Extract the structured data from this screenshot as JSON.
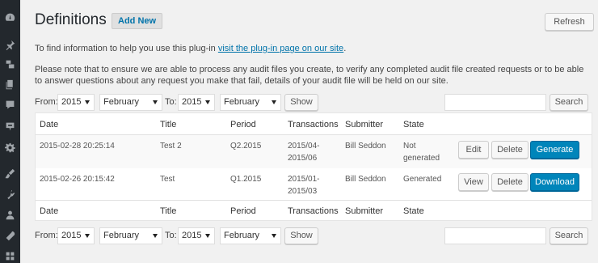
{
  "sidebar": {
    "icons": [
      "dashboard-icon",
      "pin-icon",
      "media-icon",
      "pages-icon",
      "comments-icon",
      "feedback-icon",
      "settings-icon",
      "appearance-icon",
      "plugins-icon",
      "users-icon",
      "tools-icon",
      "grid-icon"
    ]
  },
  "header": {
    "title": "Definitions",
    "add_new": "Add New",
    "refresh": "Refresh"
  },
  "info": {
    "line1_prefix": "To find information to help you use this plug-in ",
    "line1_link": "visit the plug-in page on our site",
    "line1_suffix": ".",
    "line2": "Please note that to ensure we are able to process any audit files you create, to verify any completed audit file created requests or to be able to answer questions about any request you make that fail, details of your audit file will be held on our site."
  },
  "filter": {
    "from_label": "From:",
    "to_label": "To:",
    "from_year": "2015",
    "from_month": "February",
    "to_year": "2015",
    "to_month": "February",
    "show": "Show",
    "search": "Search",
    "search_value": ""
  },
  "table": {
    "columns": [
      "Date",
      "Title",
      "Period",
      "Transactions",
      "Submitter",
      "State"
    ],
    "rows": [
      {
        "date": "2015-02-28 20:25:14",
        "title": "Test 2",
        "period": "Q2.2015",
        "transactions_1": "2015/04-",
        "transactions_2": "2015/06",
        "submitter": "Bill Seddon",
        "state_1": "Not",
        "state_2": "generated",
        "btn1": "Edit",
        "btn2": "Delete",
        "btn3": "Generate"
      },
      {
        "date": "2015-02-26 20:15:42",
        "title": "Test",
        "period": "Q1.2015",
        "transactions_1": "2015/01-",
        "transactions_2": "2015/03",
        "submitter": "Bill Seddon",
        "state_1": "Generated",
        "state_2": "",
        "btn1": "View",
        "btn2": "Delete",
        "btn3": "Download"
      }
    ]
  },
  "colors": {
    "sidebar": "#23282d",
    "primary": "#0085ba",
    "link": "#0073aa"
  }
}
